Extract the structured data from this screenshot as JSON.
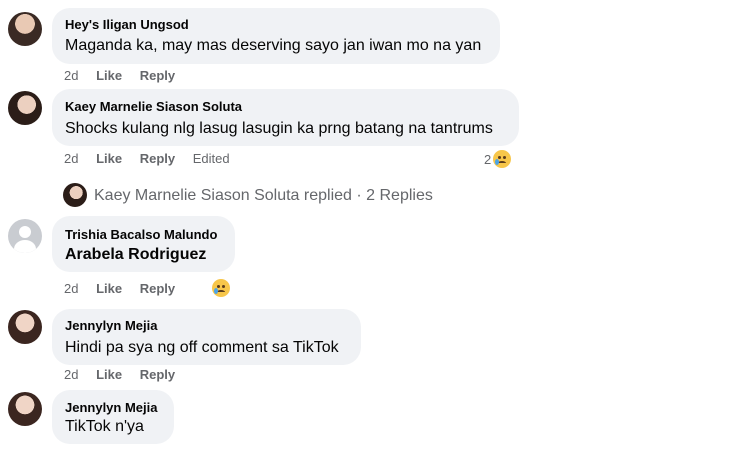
{
  "comments": [
    {
      "name": "Hey's Iligan Ungsod",
      "text": "Maganda ka, may mas deserving sayo jan iwan mo na yan",
      "time": "2d",
      "like": "Like",
      "reply": "Reply"
    },
    {
      "name": "Kaey Marnelie Siason Soluta",
      "text": "Shocks kulang nlg lasug lasugin ka prng batang na tantrums",
      "time": "2d",
      "like": "Like",
      "reply": "Reply",
      "edited": "Edited",
      "reaction_count": "2",
      "reaction_icon": "crying-face"
    },
    {
      "name": "Trishia Bacalso Malundo",
      "text": "Arabela Rodriguez",
      "time": "2d",
      "like": "Like",
      "reply": "Reply",
      "reaction_icon": "crying-face"
    },
    {
      "name": "Jennylyn Mejia",
      "text": "Hindi pa sya ng off comment sa TikTok",
      "time": "2d",
      "like": "Like",
      "reply": "Reply"
    },
    {
      "name": "Jennylyn Mejia",
      "text": "TikTok n'ya"
    }
  ],
  "replies_summary": "Kaey Marnelie Siason Soluta replied · 2 Replies",
  "colors": {
    "bubble": "#f0f2f5",
    "meta": "#65676b",
    "text": "#050505"
  }
}
